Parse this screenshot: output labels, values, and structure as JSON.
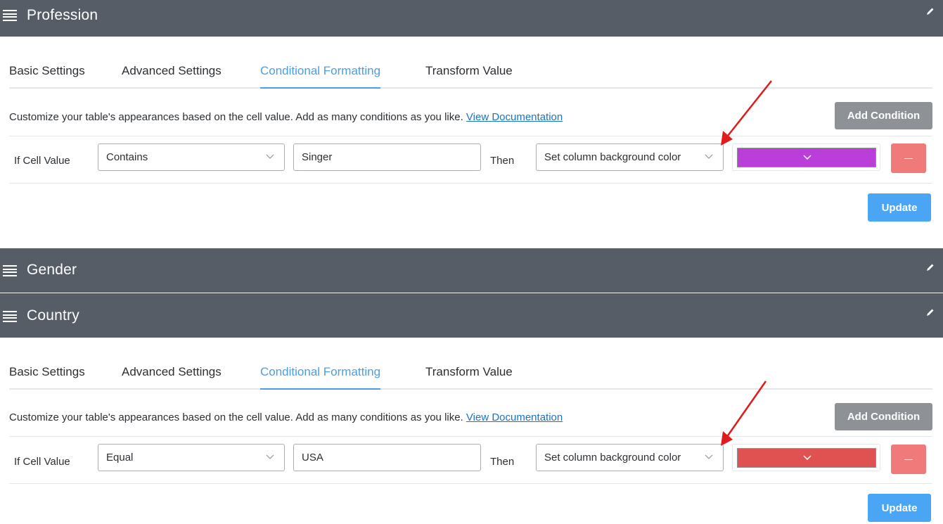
{
  "columns": [
    {
      "title": "Profession",
      "tabs": [
        "Basic Settings",
        "Advanced Settings",
        "Conditional Formatting",
        "Transform Value"
      ],
      "active_tab": "Conditional Formatting",
      "description": "Customize your table's appearances based on the cell value. Add as many conditions as you like. ",
      "doc_link": "View Documentation",
      "add_condition": "Add Condition",
      "condition": {
        "if_label": "If Cell Value",
        "operator": "Contains",
        "value": "Singer",
        "then_label": "Then",
        "action": "Set column background color",
        "color": "#b93fd8"
      },
      "update": "Update"
    },
    {
      "title": "Gender"
    },
    {
      "title": "Country",
      "tabs": [
        "Basic Settings",
        "Advanced Settings",
        "Conditional Formatting",
        "Transform Value"
      ],
      "active_tab": "Conditional Formatting",
      "description": "Customize your table's appearances based on the cell value. Add as many conditions as you like. ",
      "doc_link": "View Documentation",
      "add_condition": "Add Condition",
      "condition": {
        "if_label": "If Cell Value",
        "operator": "Equal",
        "value": "USA",
        "then_label": "Then",
        "action": "Set column background color",
        "color": "#e05252"
      },
      "update": "Update"
    }
  ],
  "colors": {
    "header_bg": "#565d66",
    "active_tab": "#4a9ee8",
    "update_button": "#4aa5f5",
    "remove_button": "#f07a7a",
    "annotation_arrow": "#e01b1b"
  },
  "icons": {
    "drag": "drag-handle-icon",
    "edit": "pencil-icon",
    "dropdown": "chevron-down-icon",
    "remove": "minus-icon"
  }
}
